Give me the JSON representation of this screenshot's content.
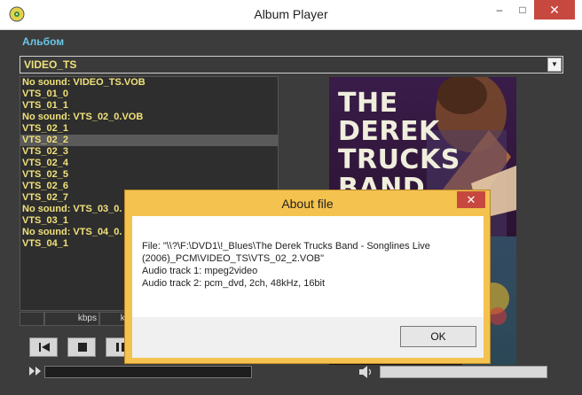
{
  "window": {
    "title": "Album Player",
    "min": "–",
    "max": "□",
    "close": "✕"
  },
  "album": {
    "label": "Альбом",
    "selected": "VIDEO_TS"
  },
  "tracks": [
    "No sound: VIDEO_TS.VOB",
    "VTS_01_0",
    "VTS_01_1",
    "No sound: VTS_02_0.VOB",
    "VTS_02_1",
    "VTS_02_2",
    "VTS_02_3",
    "VTS_02_4",
    "VTS_02_5",
    "VTS_02_6",
    "VTS_02_7",
    "No sound: VTS_03_0.",
    "VTS_03_1",
    "No sound: VTS_04_0.",
    "VTS_04_1"
  ],
  "selected_track_index": 5,
  "status": {
    "kbps": "kbps",
    "khz": "kHz"
  },
  "cover": {
    "line1": "THE",
    "line2": "DEREK",
    "line3": "TRUCKS",
    "line4": "BAND"
  },
  "dialog": {
    "title": "About file",
    "close": "✕",
    "line1": "File: \"\\\\?\\F:\\DVD1\\!_Blues\\The Derek Trucks Band - Songlines Live (2006)_PCM\\VIDEO_TS\\VTS_02_2.VOB\"",
    "line2": "Audio track 1: mpeg2video",
    "line3": "Audio track 2: pcm_dvd, 2ch, 48kHz, 16bit",
    "ok": "OK"
  },
  "icons": [
    "app-icon",
    "minimize-icon",
    "maximize-icon",
    "close-icon",
    "dropdown-arrow-icon",
    "previous-icon",
    "stop-icon",
    "pause-icon",
    "seek-icon",
    "volume-icon"
  ],
  "colors": {
    "track_text": "#f0e17a",
    "album_label": "#69c6e8",
    "dialog_frame": "#f4c24e",
    "close_red": "#c7483f"
  }
}
